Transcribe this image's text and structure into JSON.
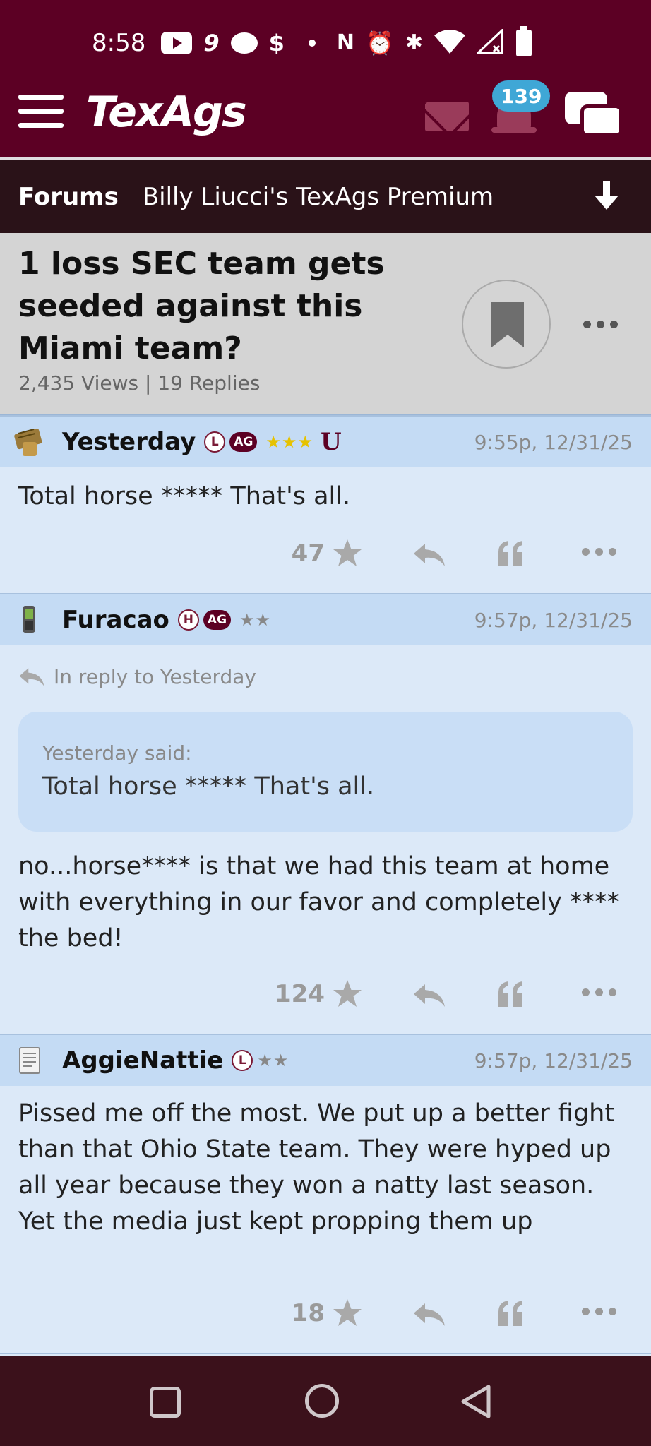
{
  "status_bar": {
    "time": "8:58"
  },
  "header": {
    "logo": "TexAgs",
    "notification_count": "139"
  },
  "forum_bar": {
    "forums_label": "Forums",
    "forum_name": "Billy Liucci's TexAgs Premium"
  },
  "thread": {
    "title": "1 loss SEC team gets seeded against this Miami team?",
    "stats": "2,435 Views | 19 Replies"
  },
  "posts": [
    {
      "username": "Yesterday",
      "level": "L",
      "ag_badge": "AG",
      "stars": "★★★",
      "star_color": "#e6c200",
      "extra_badge": "U",
      "timestamp": "9:55p, 12/31/25",
      "body": "Total horse ***** That's all.",
      "rating": "47"
    },
    {
      "username": "Furacao",
      "level": "H",
      "ag_badge": "AG",
      "stars": "★★",
      "star_color": "#888888",
      "timestamp": "9:57p, 12/31/25",
      "reply_to": "In reply to Yesterday",
      "quote_said": "Yesterday said:",
      "quote_text": "Total horse ***** That's all.",
      "body": "no...horse**** is that we had this team at home with everything in our favor and completely **** the bed!",
      "rating": "124"
    },
    {
      "username": "AggieNattie",
      "level": "L",
      "stars": "★★",
      "star_color": "#888888",
      "timestamp": "9:57p, 12/31/25",
      "body": "Pissed me off the most. We put up a better fight than that Ohio State team. They were hyped up all year because they won a natty last season. Yet the media just kept propping them up",
      "rating": "18"
    }
  ],
  "colors": {
    "maroon": "#5c0024",
    "post_bg": "#dce9f8",
    "post_header_bg": "#c4dbf4",
    "badge_blue": "#3fa7d6"
  }
}
